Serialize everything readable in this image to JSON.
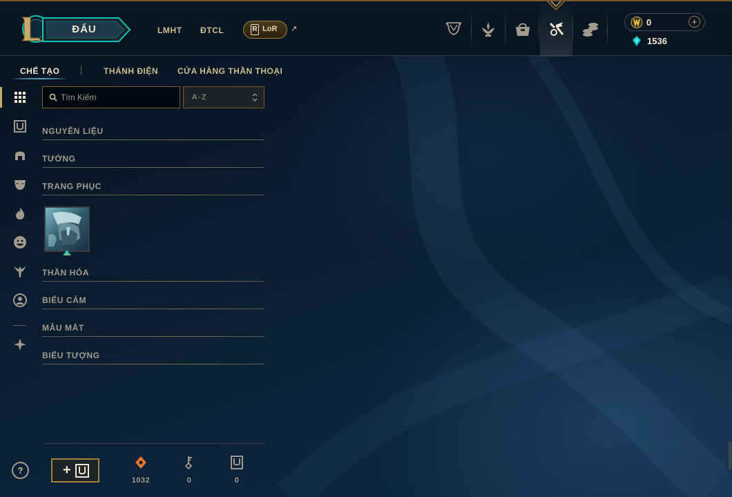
{
  "header": {
    "play_label": "ĐẤU",
    "nav": [
      "LMHT",
      "ĐTCL"
    ],
    "lor_badge": "R",
    "lor_label": "LoR",
    "external_arrow": "↗",
    "icons": [
      "trophy-icon",
      "rank-icon",
      "store-bag-icon",
      "crafting-hammer-icon",
      "coins-icon"
    ],
    "active_icon": "crafting-hammer-icon",
    "currency": {
      "rp": "0",
      "be": "1536",
      "add": "+"
    }
  },
  "subtabs": [
    {
      "label": "CHẾ TẠO",
      "active": true
    },
    {
      "label": "THÁNH ĐIỆN",
      "active": false
    },
    {
      "label": "CỬA HÀNG THẦN THOẠI",
      "active": false
    }
  ],
  "rail": {
    "icons": [
      "grid-icon",
      "chest-icon",
      "helmet-icon",
      "mask-icon",
      "flame-icon",
      "emote-face-icon",
      "ward-icon",
      "profile-icon",
      "blue-essence-spark-icon"
    ],
    "active": "grid-icon"
  },
  "search": {
    "placeholder": "Tìm Kiếm",
    "value": ""
  },
  "sort": {
    "selected": "A-Z"
  },
  "categories": [
    {
      "label": "NGUYÊN LIỆU"
    },
    {
      "label": "TƯỚNG"
    },
    {
      "label": "TRANG PHỤC"
    },
    {
      "label": "THẦN HỎA"
    },
    {
      "label": "BIỂU CẢM"
    },
    {
      "label": "MẪU MẮT"
    },
    {
      "label": "BIỂU TƯỢNG"
    }
  ],
  "items": {
    "skin_shards": [
      {
        "icon": "skin-shard-tile"
      }
    ]
  },
  "footer": {
    "help": "?",
    "add_chest": "+",
    "stats": [
      {
        "icon": "orange-essence-icon",
        "value": "1032"
      },
      {
        "icon": "key-icon",
        "value": "0"
      },
      {
        "icon": "chest-icon",
        "value": "0"
      }
    ]
  },
  "colors": {
    "gold": "#c8aa6e",
    "gold_dark": "#785a28",
    "text_light": "#f0e6d2",
    "text_muted": "#a09b8c",
    "accent_blue": "#0ac8b9",
    "background": "#0a1a2a"
  }
}
